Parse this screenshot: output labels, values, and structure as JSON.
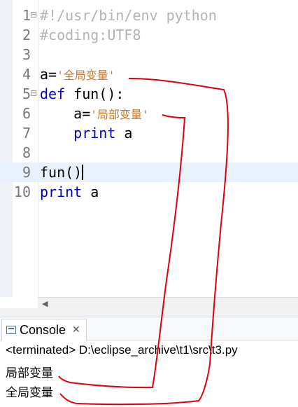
{
  "editor": {
    "lines": [
      {
        "num": "1",
        "parts": [
          {
            "t": "#!/usr/bin/env python",
            "c": "cmt"
          }
        ]
      },
      {
        "num": "2",
        "parts": [
          {
            "t": "#coding:UTF8",
            "c": "cmt"
          }
        ]
      },
      {
        "num": "3",
        "parts": []
      },
      {
        "num": "4",
        "parts": [
          {
            "t": "a=",
            "c": ""
          },
          {
            "t": "'全局变量'",
            "c": "str"
          }
        ]
      },
      {
        "num": "5",
        "parts": [
          {
            "t": "def",
            "c": "kw"
          },
          {
            "t": " fun():",
            "c": ""
          }
        ]
      },
      {
        "num": "6",
        "parts": [
          {
            "t": "    a=",
            "c": ""
          },
          {
            "t": "'局部变量'",
            "c": "str"
          }
        ]
      },
      {
        "num": "7",
        "parts": [
          {
            "t": "    ",
            "c": ""
          },
          {
            "t": "print",
            "c": "kw"
          },
          {
            "t": " a",
            "c": ""
          }
        ]
      },
      {
        "num": "8",
        "parts": []
      },
      {
        "num": "9",
        "parts": [
          {
            "t": "fun()",
            "c": ""
          }
        ]
      },
      {
        "num": "10",
        "parts": [
          {
            "t": "print",
            "c": "kw"
          },
          {
            "t": " a",
            "c": ""
          }
        ]
      }
    ]
  },
  "console": {
    "tab_label": "Console",
    "close_glyph": "✕",
    "status": "<terminated> D:\\eclipse_archive\\t1\\src\\t3.py",
    "output": [
      "局部变量",
      "全局变量"
    ]
  },
  "icons": {
    "console": "console-icon",
    "scroll_left": "◀"
  },
  "colors": {
    "keyword": "#0000c0",
    "string": "#c07a2a",
    "comment": "#b3b3b3",
    "annotation": "#e0000c"
  }
}
